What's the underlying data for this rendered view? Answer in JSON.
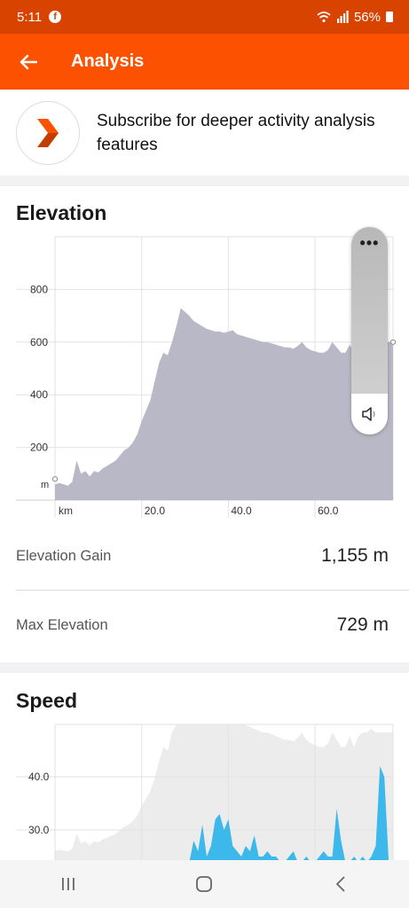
{
  "status_bar": {
    "time": "5:11",
    "battery": "56%",
    "facebook_glyph": "f"
  },
  "app_bar": {
    "title": "Analysis"
  },
  "promo": {
    "text": "Subscribe for deeper activity analysis features"
  },
  "elevation": {
    "title": "Elevation",
    "y_unit": "m",
    "x_unit": "km",
    "gain_label": "Elevation Gain",
    "gain_value": "1,155 m",
    "max_label": "Max Elevation",
    "max_value": "729 m"
  },
  "speed": {
    "title": "Speed"
  },
  "volume_panel": {
    "menu_glyph": "•••"
  },
  "colors": {
    "strava_orange": "#fc5200",
    "status_orange": "#d84300",
    "elevation_fill": "#b8b8c6",
    "speed_fill": "#3cb8ea"
  },
  "chart_data": [
    {
      "type": "area",
      "title": "Elevation",
      "xlabel": "km",
      "ylabel": "m",
      "xlim": [
        0,
        78
      ],
      "ylim": [
        0,
        1000
      ],
      "x_ticks": [
        20.0,
        40.0,
        60.0
      ],
      "x_tick_labels": [
        "20.0",
        "40.0",
        "60.0"
      ],
      "y_ticks": [
        200,
        400,
        600,
        800
      ],
      "y_tick_labels": [
        "200",
        "400",
        "600",
        "800"
      ],
      "grid": true,
      "x": [
        0,
        1,
        2,
        3,
        4,
        5,
        6,
        7,
        8,
        9,
        10,
        11,
        12,
        13,
        14,
        15,
        16,
        17,
        18,
        19,
        20,
        21,
        22,
        23,
        24,
        25,
        26,
        27,
        28,
        29,
        30,
        31,
        32,
        33,
        34,
        35,
        36,
        37,
        38,
        39,
        40,
        41,
        42,
        43,
        44,
        45,
        46,
        47,
        48,
        49,
        50,
        51,
        52,
        53,
        54,
        55,
        56,
        57,
        58,
        59,
        60,
        61,
        62,
        63,
        64,
        65,
        66,
        67,
        68,
        69,
        70,
        71,
        72,
        73,
        74,
        75,
        76,
        77,
        78
      ],
      "y": [
        60,
        65,
        60,
        55,
        70,
        150,
        100,
        110,
        90,
        110,
        105,
        120,
        130,
        140,
        150,
        170,
        190,
        200,
        220,
        250,
        300,
        340,
        380,
        450,
        520,
        560,
        550,
        600,
        660,
        729,
        715,
        700,
        680,
        670,
        660,
        650,
        645,
        640,
        640,
        635,
        640,
        645,
        630,
        625,
        620,
        615,
        610,
        605,
        600,
        600,
        595,
        590,
        585,
        580,
        580,
        575,
        585,
        600,
        580,
        570,
        565,
        560,
        560,
        570,
        600,
        580,
        560,
        560,
        590,
        560,
        590,
        600,
        600,
        610,
        600,
        600,
        600,
        600,
        600
      ]
    },
    {
      "type": "area",
      "title": "Speed",
      "ylim": [
        0,
        50
      ],
      "y_ticks": [
        30.0,
        40.0
      ],
      "y_tick_labels": [
        "30.0",
        "40.0"
      ],
      "grid": true,
      "x": [
        0,
        5,
        10,
        15,
        20,
        25,
        29,
        30,
        31,
        32,
        33,
        34,
        35,
        36,
        37,
        38,
        39,
        40,
        41,
        42,
        43,
        44,
        45,
        46,
        47,
        48,
        49,
        50,
        51,
        52,
        53,
        54,
        55,
        56,
        57,
        58,
        59,
        60,
        61,
        62,
        63,
        64,
        65,
        66,
        67,
        68,
        69,
        70,
        71,
        72,
        73,
        74,
        75,
        76,
        77,
        78
      ],
      "series": [
        {
          "values": [
            0,
            0,
            0,
            0,
            0,
            0,
            0,
            0,
            0,
            28,
            26,
            31,
            25,
            27,
            32,
            33,
            30,
            32,
            27,
            26,
            25,
            27,
            26,
            29,
            25,
            25,
            26,
            25,
            25,
            24,
            24,
            25,
            26,
            24,
            24,
            25,
            24,
            24,
            25,
            26,
            25,
            25,
            34,
            28,
            24,
            24,
            25,
            24,
            25,
            24,
            25,
            27,
            42,
            40,
            24,
            24
          ]
        }
      ]
    }
  ]
}
